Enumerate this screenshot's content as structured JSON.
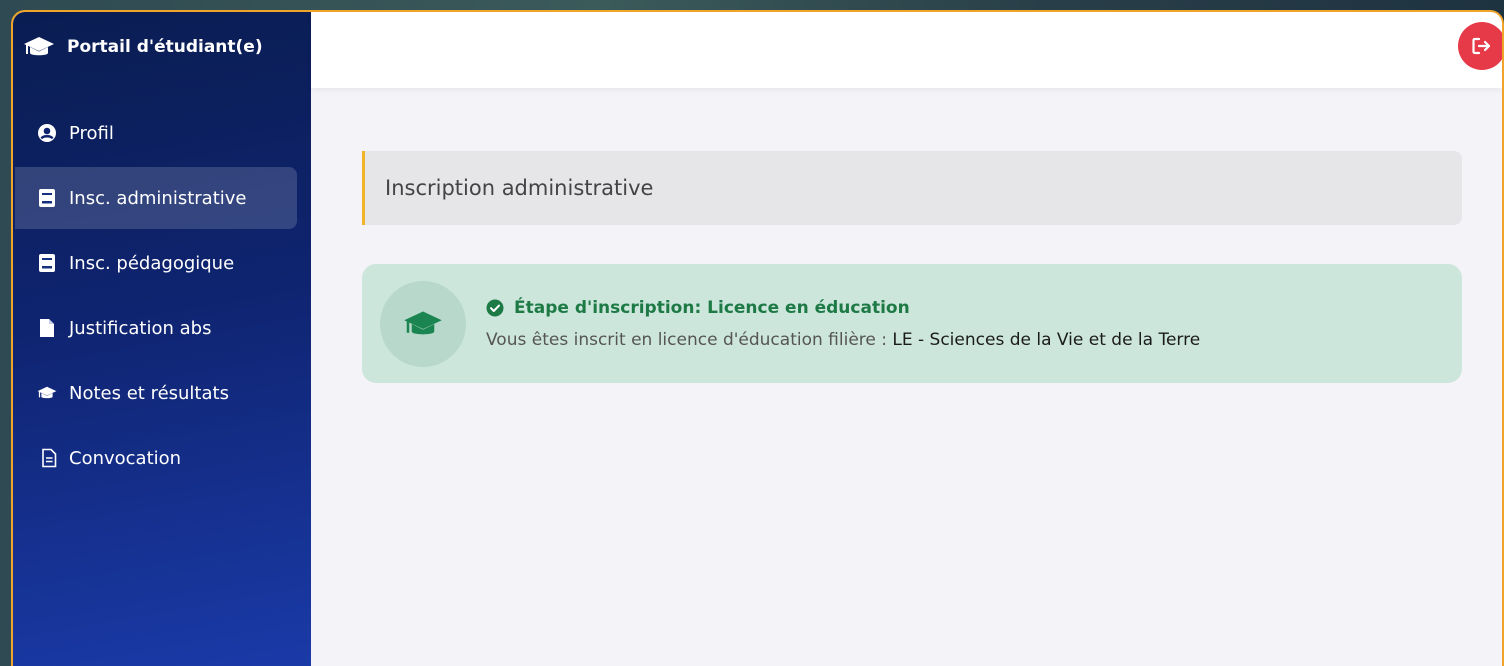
{
  "app": {
    "title": "Portail d'étudiant(e)"
  },
  "sidebar": {
    "items": [
      {
        "label": "Profil",
        "icon": "user-circle-icon",
        "active": false
      },
      {
        "label": "Insc. administrative",
        "icon": "book-icon",
        "active": true
      },
      {
        "label": "Insc. pédagogique",
        "icon": "book-icon",
        "active": false
      },
      {
        "label": "Justification abs",
        "icon": "file-icon",
        "active": false
      },
      {
        "label": "Notes et résultats",
        "icon": "graduation-cap-icon",
        "active": false
      },
      {
        "label": "Convocation",
        "icon": "file-text-icon",
        "active": false
      }
    ]
  },
  "topbar": {
    "logout_icon": "logout-icon"
  },
  "main": {
    "page_title": "Inscription administrative",
    "alert": {
      "title": "Étape d'inscription: Licence en éducation",
      "text_prefix": "Vous êtes inscrit en licence d'éducation filière : ",
      "text_value": "LE - Sciences de la Vie et de la Terre"
    }
  },
  "colors": {
    "accent_orange": "#f0a52a",
    "logout_red": "#e63a49",
    "success_green": "#1d7a45",
    "sidebar_top": "#0a1d52",
    "sidebar_bottom": "#1a3aa8"
  }
}
